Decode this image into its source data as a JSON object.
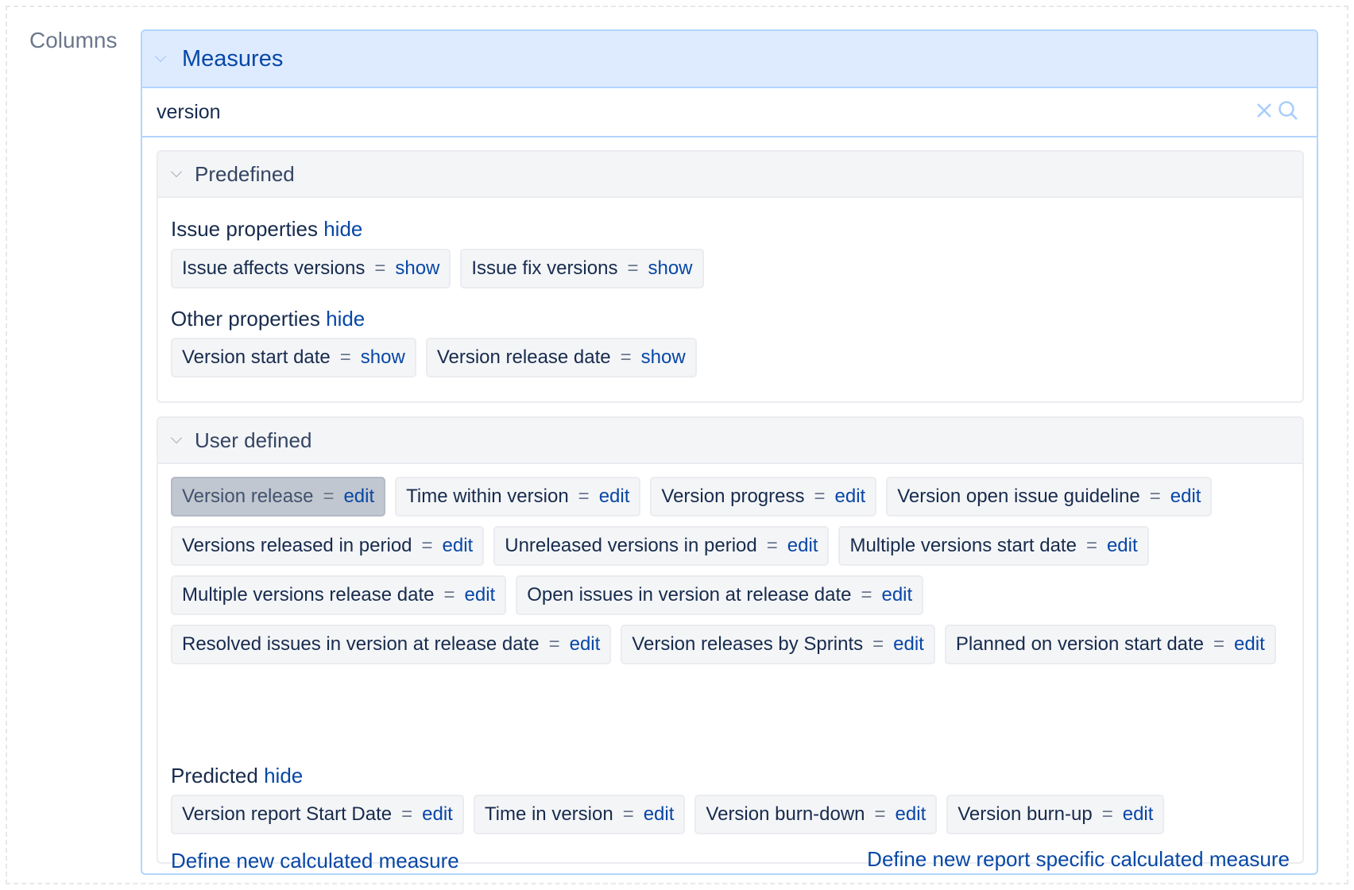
{
  "columns_label": "Columns",
  "measures": {
    "title": "Measures",
    "search": {
      "value": "version",
      "placeholder": ""
    },
    "icons": {
      "clear": "close-icon",
      "search": "search-icon"
    }
  },
  "predefined": {
    "title": "Predefined",
    "groups": [
      {
        "title": "Issue properties",
        "toggle": "hide",
        "items": [
          {
            "label": "Issue affects versions",
            "action": "show"
          },
          {
            "label": "Issue fix versions",
            "action": "show"
          }
        ]
      },
      {
        "title": "Other properties",
        "toggle": "hide",
        "items": [
          {
            "label": "Version start date",
            "action": "show"
          },
          {
            "label": "Version release date",
            "action": "show"
          }
        ]
      }
    ]
  },
  "user_defined": {
    "title": "User defined",
    "items": [
      {
        "label": "Version release",
        "action": "edit",
        "selected": true
      },
      {
        "label": "Time within version",
        "action": "edit"
      },
      {
        "label": "Version progress",
        "action": "edit"
      },
      {
        "label": "Version open issue guideline",
        "action": "edit"
      },
      {
        "label": "Versions released in period",
        "action": "edit"
      },
      {
        "label": "Unreleased versions in period",
        "action": "edit"
      },
      {
        "label": "Multiple versions start date",
        "action": "edit"
      },
      {
        "label": "Multiple versions release date",
        "action": "edit"
      },
      {
        "label": "Open issues in version at release date",
        "action": "edit"
      },
      {
        "label": "Resolved issues in version at release date",
        "action": "edit"
      },
      {
        "label": "Version releases by Sprints",
        "action": "edit"
      },
      {
        "label": "Planned on version start date",
        "action": "edit"
      }
    ],
    "predicted": {
      "title": "Predicted",
      "toggle": "hide",
      "items": [
        {
          "label": "Version report Start Date",
          "action": "edit"
        },
        {
          "label": "Time in version",
          "action": "edit"
        },
        {
          "label": "Version burn-down",
          "action": "edit"
        },
        {
          "label": "Version burn-up",
          "action": "edit"
        }
      ]
    },
    "links": {
      "define_new": "Define new calculated measure",
      "define_report_specific": "Define new report specific calculated measure"
    }
  },
  "eq_symbol": "="
}
